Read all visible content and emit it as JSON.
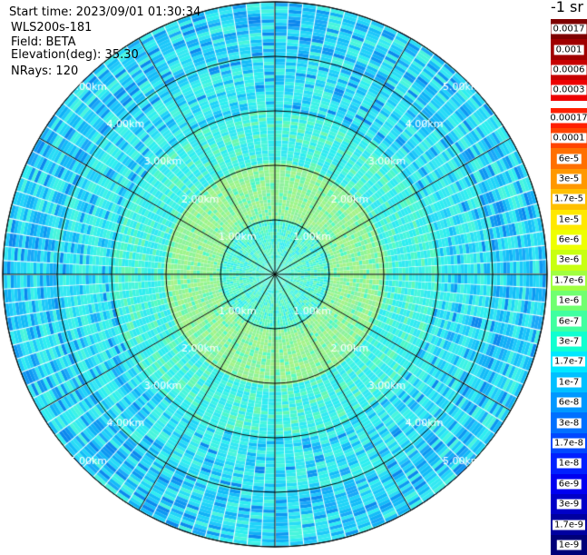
{
  "header": {
    "start_time": "Start time: 2023/09/01 01:30:34",
    "instrument": "WLS200s-181",
    "field": "Field: BETA",
    "elevation": "Elevation(deg): 35.30",
    "nrays": "NRays: 120"
  },
  "colorbar": {
    "unit": "-1 sr",
    "top_labels": [
      "0.0017",
      "0.001",
      "0.0006",
      "0.0003"
    ],
    "top_colors": [
      "#7f0000",
      "#a00000",
      "#c80000",
      "#ee0000"
    ],
    "bottom_labels": [
      "0.00017",
      "0.0001",
      "6e-5",
      "3e-5",
      "1.7e-5",
      "1e-5",
      "6e-6",
      "3e-6",
      "1.7e-6",
      "1e-6",
      "6e-7",
      "3e-7",
      "1.7e-7",
      "1e-7",
      "6e-8",
      "3e-8",
      "1.7e-8",
      "1e-8",
      "6e-9",
      "3e-9",
      "1.7e-9",
      "1e-9"
    ],
    "bottom_colors": [
      "#ff2000",
      "#ff4400",
      "#ff7000",
      "#ff9800",
      "#ffc000",
      "#ffe800",
      "#eeff00",
      "#c8ff10",
      "#a0ff40",
      "#70ff70",
      "#40ffa0",
      "#10ffd0",
      "#00e8ff",
      "#00c0ff",
      "#0098ff",
      "#0070ff",
      "#0048ff",
      "#0020ff",
      "#0000f0",
      "#0000c8",
      "#0000a0",
      "#000078"
    ]
  },
  "chart_data": {
    "type": "heatmap",
    "projection": "polar (PPI scan)",
    "field": "BETA",
    "nrays": 120,
    "elevation_deg": 35.3,
    "range_rings": [
      "1.00km",
      "2.00km",
      "3.00km",
      "4.00km",
      "5.00km"
    ],
    "range_ring_km": [
      1,
      2,
      3,
      4,
      5
    ],
    "max_range_km": 5,
    "azimuth_spokes_deg": [
      0,
      30,
      60,
      90,
      120,
      150,
      180,
      210,
      240,
      270,
      300,
      330
    ],
    "radial_profile": [
      {
        "range_km": [
          0.0,
          1.0
        ],
        "value": "approx. 6e-7 to 3e-7 (cyan-green)"
      },
      {
        "range_km": [
          1.0,
          2.0
        ],
        "value": "approx. 1e-6 to 6e-7 (light green)"
      },
      {
        "range_km": [
          2.0,
          3.0
        ],
        "value": "approx. 3e-7 (cyan)"
      },
      {
        "range_km": [
          3.0,
          4.0
        ],
        "value": "approx. 3e-7 to 1.7e-7 (cyan / light blue)"
      },
      {
        "range_km": [
          4.0,
          5.0
        ],
        "value": "approx. 1.7e-7 to 6e-8 (cyan to blue, speckled)"
      }
    ]
  }
}
